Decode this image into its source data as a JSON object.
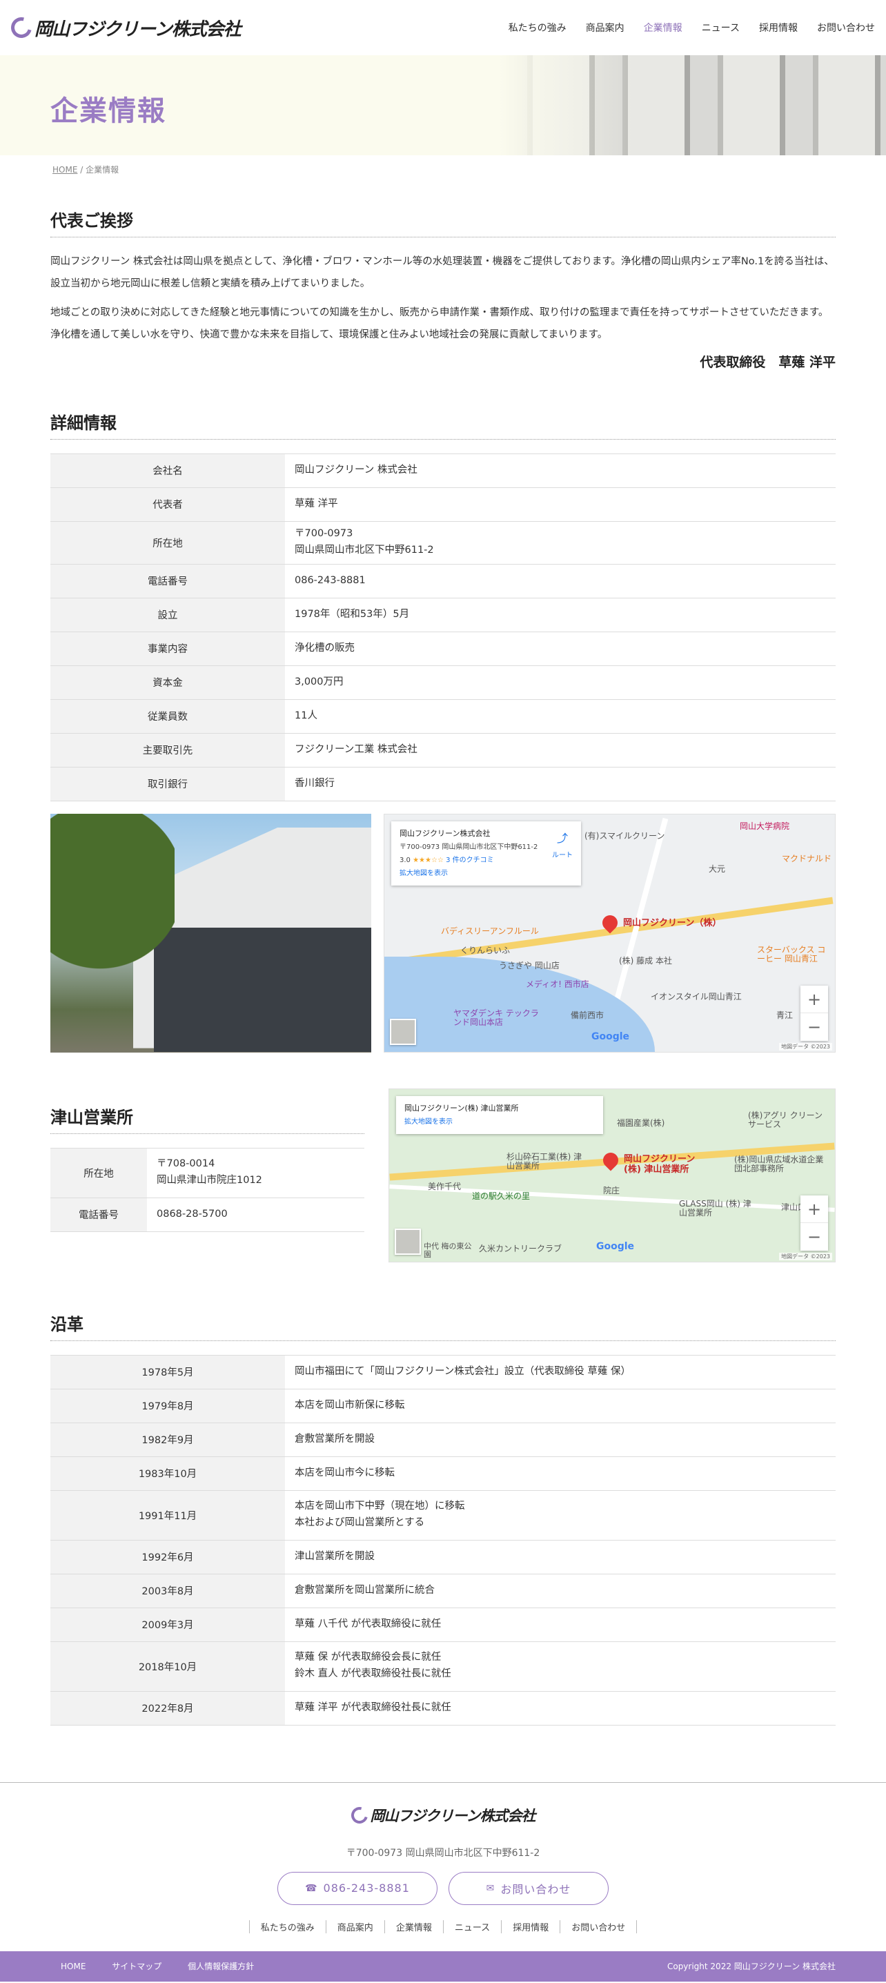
{
  "header": {
    "logo_text": "岡山フジクリーン株式会社",
    "nav": [
      "私たちの強み",
      "商品案内",
      "企業情報",
      "ニュース",
      "採用情報",
      "お問い合わせ"
    ],
    "active_nav": "企業情報"
  },
  "hero": {
    "title": "企業情報"
  },
  "breadcrumb": {
    "home": "HOME",
    "sep": "/",
    "current": "企業情報"
  },
  "greeting": {
    "title": "代表ご挨拶",
    "p1": "岡山フジクリーン 株式会社は岡山県を拠点として、浄化槽・ブロワ・マンホール等の水処理装置・機器をご提供しております。浄化槽の岡山県内シェア率No.1を誇る当社は、設立当初から地元岡山に根差し信頼と実績を積み上げてまいりました。",
    "p2": "地域ごとの取り決めに対応してきた経験と地元事情についての知識を生かし、販売から申請作業・書類作成、取り付けの監理まで責任を持ってサポートさせていただきます。浄化槽を通して美しい水を守り、快適で豊かな未来を目指して、環境保護と住みよい地域社会の発展に貢献してまいります。",
    "signature": "代表取締役　草薙 洋平"
  },
  "details": {
    "title": "詳細情報",
    "rows": [
      {
        "key": "会社名",
        "val1": "岡山フジクリーン 株式会社",
        "val2": ""
      },
      {
        "key": "代表者",
        "val1": "草薙 洋平",
        "val2": ""
      },
      {
        "key": "所在地",
        "val1": "〒700-0973",
        "val2": "岡山県岡山市北区下中野611-2"
      },
      {
        "key": "電話番号",
        "val1": "086-243-8881",
        "val2": ""
      },
      {
        "key": "設立",
        "val1": "1978年（昭和53年）5月",
        "val2": ""
      },
      {
        "key": "事業内容",
        "val1": "浄化槽の販売",
        "val2": ""
      },
      {
        "key": "資本金",
        "val1": "3,000万円",
        "val2": ""
      },
      {
        "key": "従業員数",
        "val1": "11人",
        "val2": ""
      },
      {
        "key": "主要取引先",
        "val1": "フジクリーン工業 株式会社",
        "val2": ""
      },
      {
        "key": "取引銀行",
        "val1": "香川銀行",
        "val2": ""
      }
    ]
  },
  "map_main": {
    "card_title": "岡山フジクリーン株式会社",
    "card_addr": "〒700-0973 岡山県岡山市北区下中野611-2",
    "rating": "3.0",
    "stars": "★★★☆☆",
    "reviews": "3 件のクチコミ",
    "larger_map": "拡大地図を表示",
    "directions": "ルート",
    "pin_label": "岡山フジクリーン（株）",
    "labels": [
      "(有)スマイルクリーン",
      "岡山大学病院",
      "大元",
      "マクドナルド",
      "バディスリーアンフルール",
      "くりんらいふ",
      "うさぎや 岡山店",
      "(株) 藤成 本社",
      "メディオ! 西市店",
      "ヤマダデンキ テックランド岡山本店",
      "備前西市",
      "イオンスタイル岡山青江",
      "スターバックス コーヒー 岡山青江",
      "青江"
    ],
    "zoom_in": "+",
    "zoom_out": "−",
    "google": "Google",
    "attribution": "地図データ ©2023"
  },
  "tsuyama": {
    "title": "津山営業所",
    "rows": [
      {
        "key": "所在地",
        "val1": "〒708-0014",
        "val2": "岡山県津山市院庄1012"
      },
      {
        "key": "電話番号",
        "val1": "0868-28-5700",
        "val2": ""
      }
    ]
  },
  "map_tsuyama": {
    "card_title": "岡山フジクリーン(株) 津山営業所",
    "larger_map": "拡大地図を表示",
    "pin_label": "岡山フジクリーン (株) 津山営業所",
    "labels": [
      "福園産業(株)",
      "(株)アグリ クリーンサービス",
      "杉山砕石工業(株) 津山営業所",
      "(株)岡山県広域水道企業団北部事務所",
      "美作千代",
      "道の駅久米の里",
      "院庄",
      "GLASS岡山 (株) 津山営業所",
      "津山口",
      "久米カントリークラブ",
      "中代 梅の東公園"
    ],
    "zoom_in": "+",
    "zoom_out": "−",
    "google": "Google",
    "attribution": "地図データ ©2023"
  },
  "history": {
    "title": "沿革",
    "rows": [
      {
        "key": "1978年5月",
        "val1": "岡山市福田にて「岡山フジクリーン株式会社」設立（代表取締役 草薙 保）",
        "val2": ""
      },
      {
        "key": "1979年8月",
        "val1": "本店を岡山市新保に移転",
        "val2": ""
      },
      {
        "key": "1982年9月",
        "val1": "倉敷営業所を開設",
        "val2": ""
      },
      {
        "key": "1983年10月",
        "val1": "本店を岡山市今に移転",
        "val2": ""
      },
      {
        "key": "1991年11月",
        "val1": "本店を岡山市下中野（現在地）に移転",
        "val2": "本社および岡山営業所とする"
      },
      {
        "key": "1992年6月",
        "val1": "津山営業所を開設",
        "val2": ""
      },
      {
        "key": "2003年8月",
        "val1": "倉敷営業所を岡山営業所に統合",
        "val2": ""
      },
      {
        "key": "2009年3月",
        "val1": "草薙 八千代 が代表取締役に就任",
        "val2": ""
      },
      {
        "key": "2018年10月",
        "val1": "草薙 保 が代表取締役会長に就任",
        "val2": "鈴木 直人 が代表取締役社長に就任"
      },
      {
        "key": "2022年8月",
        "val1": "草薙 洋平 が代表取締役社長に就任",
        "val2": ""
      }
    ]
  },
  "footer": {
    "logo_text": "岡山フジクリーン株式会社",
    "address": "〒700-0973 岡山県岡山市北区下中野611-2",
    "phone_button": "086-243-8881",
    "contact_button": "お問い合わせ",
    "phone_icon": "☎",
    "mail_icon": "✉",
    "links": [
      "私たちの強み",
      "商品案内",
      "企業情報",
      "ニュース",
      "採用情報",
      "お問い合わせ"
    ],
    "bottom_links": [
      "HOME",
      "サイトマップ",
      "個人情報保護方針"
    ],
    "copyright": "Copyright 2022 岡山フジクリーン 株式会社"
  },
  "colors": {
    "accent": "#9a7cc4",
    "hero_bg": "#fbfbee",
    "table_key_bg": "#f2f2f2"
  }
}
